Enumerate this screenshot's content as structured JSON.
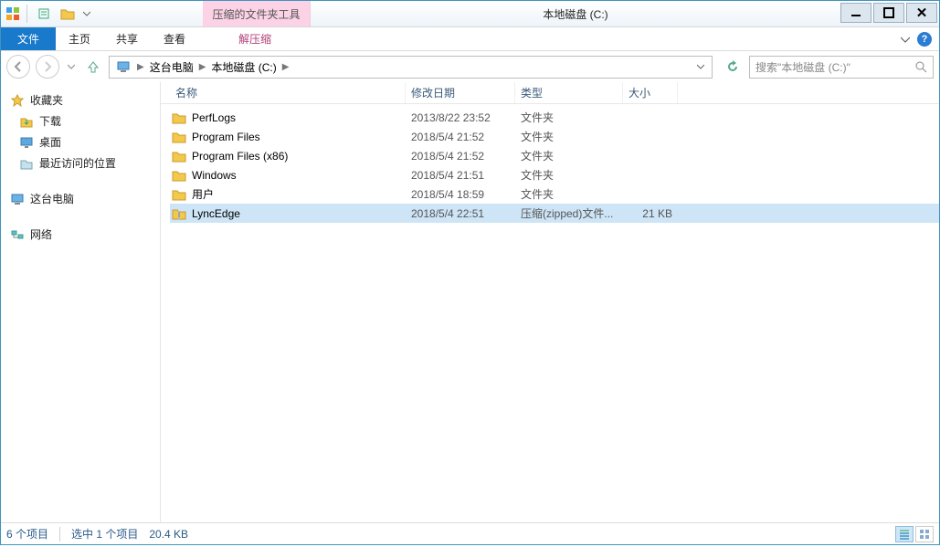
{
  "window": {
    "contextual_label": "压缩的文件夹工具",
    "title": "本地磁盘 (C:)"
  },
  "ribbon": {
    "file": "文件",
    "tabs": [
      "主页",
      "共享",
      "查看"
    ],
    "contextual_tab": "解压缩"
  },
  "breadcrumb": {
    "root": "这台电脑",
    "current": "本地磁盘 (C:)"
  },
  "search": {
    "placeholder": "搜索\"本地磁盘 (C:)\""
  },
  "sidebar": {
    "fav_header": "收藏夹",
    "fav_items": [
      "下载",
      "桌面",
      "最近访问的位置"
    ],
    "computer": "这台电脑",
    "network": "网络"
  },
  "columns": {
    "name": "名称",
    "date": "修改日期",
    "type": "类型",
    "size": "大小"
  },
  "rows": [
    {
      "name": "PerfLogs",
      "date": "2013/8/22 23:52",
      "type": "文件夹",
      "size": "",
      "icon": "folder",
      "selected": false
    },
    {
      "name": "Program Files",
      "date": "2018/5/4 21:52",
      "type": "文件夹",
      "size": "",
      "icon": "folder",
      "selected": false
    },
    {
      "name": "Program Files (x86)",
      "date": "2018/5/4 21:52",
      "type": "文件夹",
      "size": "",
      "icon": "folder",
      "selected": false
    },
    {
      "name": "Windows",
      "date": "2018/5/4 21:51",
      "type": "文件夹",
      "size": "",
      "icon": "folder",
      "selected": false
    },
    {
      "name": "用户",
      "date": "2018/5/4 18:59",
      "type": "文件夹",
      "size": "",
      "icon": "folder",
      "selected": false
    },
    {
      "name": "LyncEdge",
      "date": "2018/5/4 22:51",
      "type": "压缩(zipped)文件...",
      "size": "21 KB",
      "icon": "zip",
      "selected": true
    }
  ],
  "status": {
    "items": "6 个项目",
    "selected": "选中 1 个项目",
    "sel_size": "20.4 KB"
  }
}
